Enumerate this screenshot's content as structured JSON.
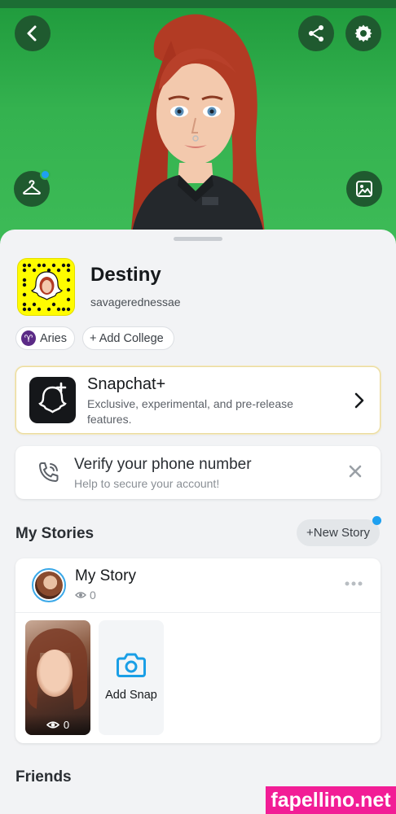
{
  "profile": {
    "display_name": "Destiny",
    "username": "savagerednessae",
    "zodiac_label": "Aries",
    "add_college_label": "+ Add College"
  },
  "snapchat_plus": {
    "title": "Snapchat+",
    "description": "Exclusive, experimental, and pre-release features."
  },
  "verify": {
    "title": "Verify your phone number",
    "subtitle": "Help to secure your account!"
  },
  "my_stories": {
    "section_title": "My Stories",
    "new_story_label": "+New Story",
    "story_title": "My Story",
    "story_views": "0",
    "snap_views": "0",
    "add_snap_label": "Add Snap"
  },
  "friends": {
    "section_title": "Friends"
  },
  "watermark": "fapellino.net",
  "colors": {
    "hero_green": "#34b24f",
    "snapcode_yellow": "#fffc00",
    "accent_blue": "#1ea0f0",
    "watermark_pink": "#f21d96"
  }
}
